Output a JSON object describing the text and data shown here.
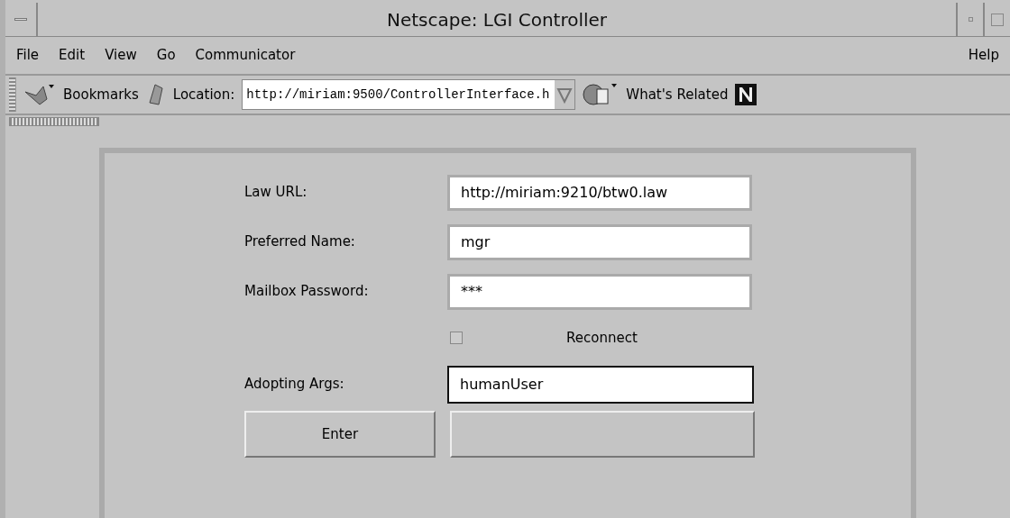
{
  "window": {
    "title": "Netscape: LGI Controller"
  },
  "menu": {
    "left": [
      "File",
      "Edit",
      "View",
      "Go",
      "Communicator"
    ],
    "right": [
      "Help"
    ]
  },
  "toolbar": {
    "bookmarks": "Bookmarks",
    "location_label": "Location:",
    "location": "http://miriam:9500/ControllerInterface.h",
    "related": "What's Related"
  },
  "form": {
    "rows": [
      {
        "kind": "field",
        "label": "Law URL:",
        "value": "http://miriam:9210/btw0.law",
        "focused": false
      },
      {
        "kind": "field",
        "label": "Preferred Name:",
        "value": "mgr",
        "focused": false
      },
      {
        "kind": "field",
        "label": "Mailbox Password:",
        "value": "***",
        "focused": false
      },
      {
        "kind": "checkbox",
        "label": "Reconnect",
        "checked": false
      },
      {
        "kind": "field",
        "label": "Adopting Args:",
        "value": "humanUser",
        "focused": true
      }
    ],
    "buttons": [
      {
        "kind": "labeled",
        "label": "Enter"
      },
      {
        "kind": "blank"
      }
    ]
  }
}
